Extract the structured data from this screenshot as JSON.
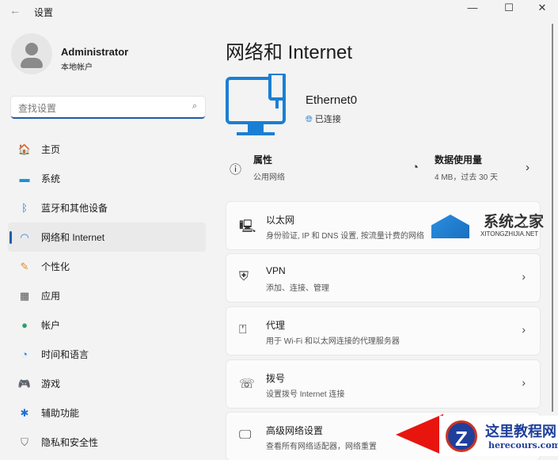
{
  "window": {
    "title": "设置",
    "back": "←",
    "minimize": "—",
    "maximize": "☐",
    "close": "✕"
  },
  "user": {
    "name": "Administrator",
    "type": "本地帐户"
  },
  "search": {
    "placeholder": "查找设置",
    "icon": "⌕"
  },
  "nav": [
    {
      "label": "主页",
      "icon": "🏠",
      "color": "#d9534f"
    },
    {
      "label": "系统",
      "icon": "▬",
      "color": "#1e90d6"
    },
    {
      "label": "蓝牙和其他设备",
      "icon": "ᛒ",
      "color": "#1f6fd0"
    },
    {
      "label": "网络和 Internet",
      "icon": "◠",
      "color": "#2a7fd4",
      "active": true
    },
    {
      "label": "个性化",
      "icon": "✎",
      "color": "#d98b2a"
    },
    {
      "label": "应用",
      "icon": "▦",
      "color": "#555"
    },
    {
      "label": "帐户",
      "icon": "●",
      "color": "#2aa06b"
    },
    {
      "label": "时间和语言",
      "icon": "◔",
      "color": "#2a7fd4"
    },
    {
      "label": "游戏",
      "icon": "🎮",
      "color": "#666"
    },
    {
      "label": "辅助功能",
      "icon": "✱",
      "color": "#1f6fd0"
    },
    {
      "label": "隐私和安全性",
      "icon": "⛉",
      "color": "#666"
    }
  ],
  "main": {
    "title": "网络和 Internet",
    "adapter": {
      "name": "Ethernet0",
      "status": "已连接"
    },
    "properties": {
      "title": "属性",
      "subtitle": "公用网络"
    },
    "data_usage": {
      "title": "数据使用量",
      "subtitle": "4 MB，过去 30 天"
    },
    "cards": [
      {
        "title": "以太网",
        "subtitle": "身份验证, IP 和 DNS 设置, 按流量计费的网络",
        "icon": "🖳"
      },
      {
        "title": "VPN",
        "subtitle": "添加、连接、管理",
        "icon": "⛨"
      },
      {
        "title": "代理",
        "subtitle": "用于 Wi-Fi 和以太网连接的代理服务器",
        "icon": "⍞"
      },
      {
        "title": "拨号",
        "subtitle": "设置拨号 Internet 连接",
        "icon": "☏"
      },
      {
        "title": "高级网络设置",
        "subtitle": "查看所有网络适配器，网络重置",
        "icon": "🖵"
      }
    ]
  },
  "watermarks": {
    "top_cn": "系统之家",
    "top_en": "XITONGZHIJIA.NET",
    "bottom_cn": "这里教程网",
    "bottom_en": "herecours.com"
  }
}
